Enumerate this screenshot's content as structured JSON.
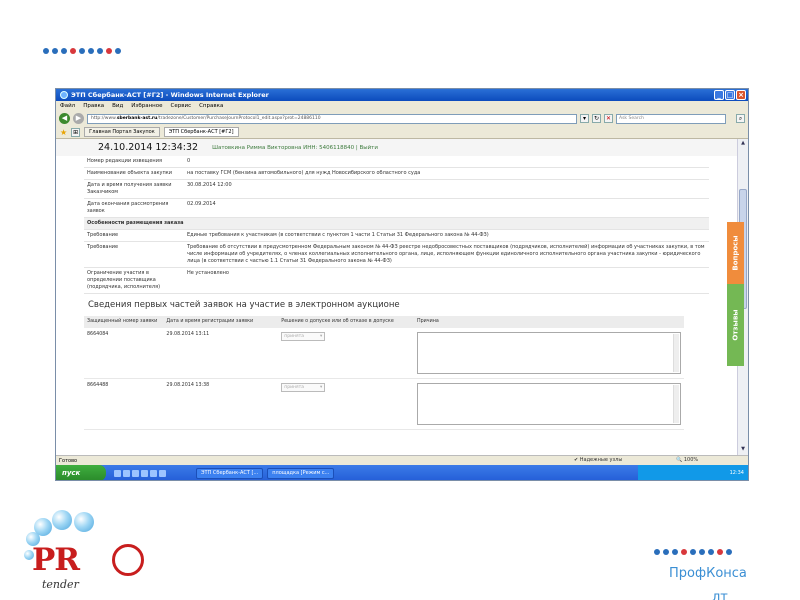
{
  "colors": {
    "dot_blue": "#2a6ebb",
    "dot_red": "#d8383c",
    "accent_orange": "#f08c3c",
    "accent_green": "#74b854",
    "title_blue": "#0c4bbd"
  },
  "window": {
    "title": "ЭТП Сбербанк-АСТ [#Г2] - Windows Internet Explorer"
  },
  "menu": [
    "Файл",
    "Правка",
    "Вид",
    "Избранное",
    "Сервис",
    "Справка"
  ],
  "address": {
    "url_prefix": "http://www.",
    "url_domain": "sberbank-ast.ru",
    "url_rest": "/tradezone/Customer/PurchaseJournProtocol1_edit.aspx?prot=24886110"
  },
  "search": {
    "placeholder": "Ask Search"
  },
  "favbar": {
    "tab1": "Главная Портал Закупок",
    "tab2": "ЭТП Сбербанк-АСТ [#Г2]"
  },
  "page": {
    "datetime": "24.10.2014 12:34:32",
    "user": "Шатовкина Римма Викторовна ИНН: 5406118840 | Выйти",
    "rows": [
      {
        "k": "Номер редакции извещения",
        "v": "0"
      },
      {
        "k": "Наименование объекта закупки",
        "v": "на поставку ГСМ (бензина автомобильного) для нужд Новосибирского областного суда"
      },
      {
        "k": "Дата и время получения заявки Заказчиком",
        "v": "30.08.2014 12:00"
      },
      {
        "k": "Дата окончания рассмотрения заявок",
        "v": "02.09.2014"
      }
    ],
    "section": "Особенности размещения заказа",
    "rows2": [
      {
        "k": "Требование",
        "v": "Единые требования к участникам (в соответствии с пунктом 1 части 1 Статьи 31 Федерального закона № 44-ФЗ)"
      },
      {
        "k": "Требование",
        "v": "Требование об отсутствии в предусмотренном Федеральным законом № 44-ФЗ реестре недобросовестных поставщиков (подрядчиков, исполнителей) информации об участниках закупки, в том числе информации об учредителях, о членах коллегиальных исполнительного органа, лице, исполняющем функции единоличного исполнительного органа участника закупки - юридического лица (в соответствии с частью 1.1 Статьи 31 Федерального закона № 44-ФЗ)"
      },
      {
        "k": "Ограничение участия в определении поставщика (подрядчика, исполнителя)",
        "v": "Не установлено"
      }
    ],
    "heading": "Сведения первых частей заявок на участие в электронном аукционе",
    "bid_headers": [
      "Защищенный номер заявки",
      "Дата и время регистрации заявки",
      "Решение о допуске или об отказе в допуске",
      "Причина"
    ],
    "bids": [
      {
        "num": "8664084",
        "date": "29.08.2014 13:11",
        "decision": "принята"
      },
      {
        "num": "8664488",
        "date": "29.08.2014 13:38",
        "decision": "принята"
      }
    ]
  },
  "sidetabs": {
    "questions": "Вопросы",
    "reviews": "Отзывы"
  },
  "status": {
    "left": "Готово",
    "zone": "Надежные узлы",
    "zoom": "100%"
  },
  "taskbar": {
    "start": "пуск",
    "btn1": "ЭТП Сбербанк-АСТ [...",
    "btn2": "площадка [Режим с...",
    "time": "12:34"
  },
  "logo": {
    "pro": "PR",
    "tender": "tender"
  },
  "brand": {
    "line1": "ПрофКонса",
    "line2": "лт"
  }
}
